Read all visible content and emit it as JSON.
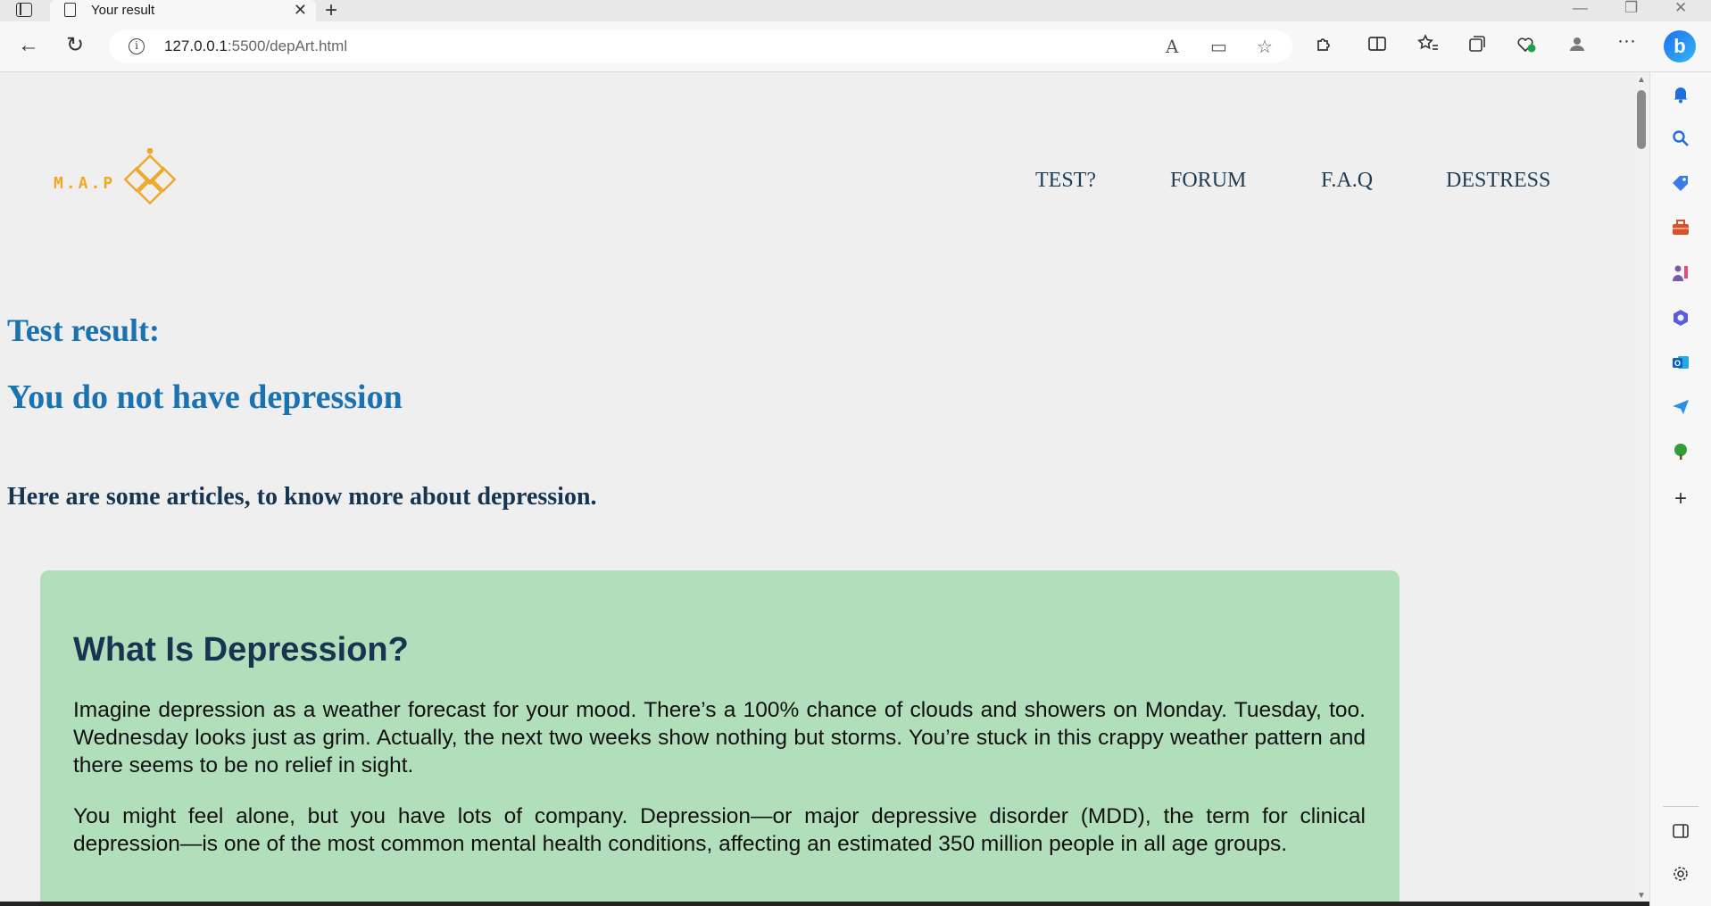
{
  "browser": {
    "tab_title": "Your result",
    "tab_close": "✕",
    "new_tab": "+",
    "url_host": "127.0.0.1",
    "url_path": ":5500/depArt.html",
    "window_controls": {
      "minimize": "—",
      "restore": "❐",
      "close": "✕"
    },
    "toolbar": {
      "back": "←",
      "reload": "↻",
      "info": "i",
      "more": "···",
      "copilot": "b"
    },
    "omnibox_icons": {
      "read_aloud": "A",
      "immersive_reader": "▭",
      "favorite": "☆"
    }
  },
  "site": {
    "logo_text": "M.A.P",
    "nav": [
      "TEST?",
      "FORUM",
      "F.A.Q",
      "DESTRESS"
    ],
    "result_heading": "Test result:",
    "result_verdict": "You do not have depression",
    "articles_intro": "Here are some articles, to know more about depression.",
    "article": {
      "title": "What Is Depression?",
      "paragraphs": [
        "Imagine depression as a weather forecast for your mood. There’s a 100% chance of clouds and showers on Monday. Tuesday, too. Wednesday looks just as grim. Actually, the next two weeks show nothing but storms. You’re stuck in this crappy weather pattern and there seems to be no relief in sight.",
        "You might feel alone, but you have lots of company. Depression—or major depressive disorder (MDD), the term for clinical depression—is one of the most common mental health conditions, affecting an estimated 350 million people in all age groups."
      ]
    }
  },
  "colors": {
    "logo": "#f0a728",
    "heading_blue": "#1a72b0",
    "heading_dark": "#173450",
    "card_bg": "#b2dfbb"
  }
}
